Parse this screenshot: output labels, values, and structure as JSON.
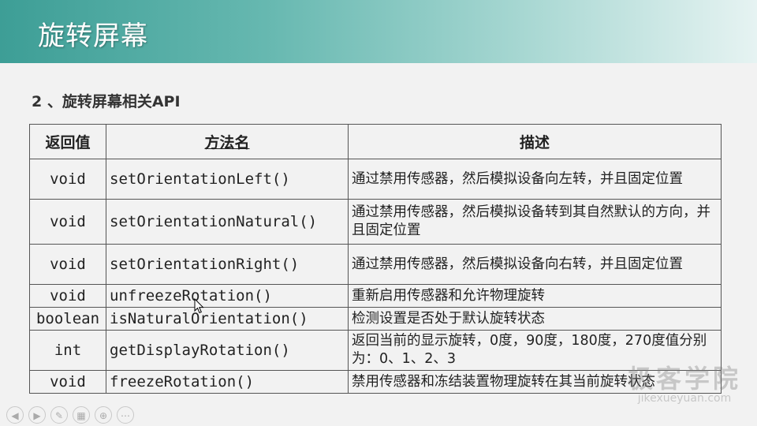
{
  "header": {
    "title": "旋转屏幕"
  },
  "section": {
    "title": "2 、旋转屏幕相关API"
  },
  "table": {
    "headers": [
      "返回值",
      "方法名",
      "描述"
    ],
    "rows": [
      {
        "ret": "void",
        "method": "setOrientationLeft()",
        "desc": "通过禁用传感器，然后模拟设备向左转，并且固定位置"
      },
      {
        "ret": "void",
        "method": "setOrientationNatural()",
        "desc": "通过禁用传感器，然后模拟设备转到其自然默认的方向，并且固定位置"
      },
      {
        "ret": "void",
        "method": "setOrientationRight()",
        "desc": "通过禁用传感器，然后模拟设备向右转，并且固定位置"
      },
      {
        "ret": "void",
        "method": "unfreezeRotation()",
        "desc": "重新启用传感器和允许物理旋转"
      },
      {
        "ret": "boolean",
        "method": "isNaturalOrientation()",
        "desc": "检测设置是否处于默认旋转状态"
      },
      {
        "ret": "int",
        "method": "getDisplayRotation()",
        "desc": "返回当前的显示旋转，0度，90度，180度，270度值分别为：0、1、2、3"
      },
      {
        "ret": "void",
        "method": "freezeRotation()",
        "desc": "禁用传感器和冻结装置物理旋转在其当前旋转状态"
      }
    ]
  },
  "watermark": {
    "main": "极客学院",
    "sub": "jikexueyuan.com"
  },
  "toolbar": {
    "icons": [
      {
        "name": "prev-icon",
        "glyph": "◀"
      },
      {
        "name": "next-icon",
        "glyph": "▶"
      },
      {
        "name": "pen-icon",
        "glyph": "✎"
      },
      {
        "name": "slides-icon",
        "glyph": "▦"
      },
      {
        "name": "zoom-icon",
        "glyph": "⊕"
      },
      {
        "name": "more-icon",
        "glyph": "⋯"
      }
    ]
  },
  "colors": {
    "header_start": "#3d9e96",
    "header_end": "#e6f3f2",
    "background": "#f2f2f2",
    "table_border": "#555555"
  }
}
